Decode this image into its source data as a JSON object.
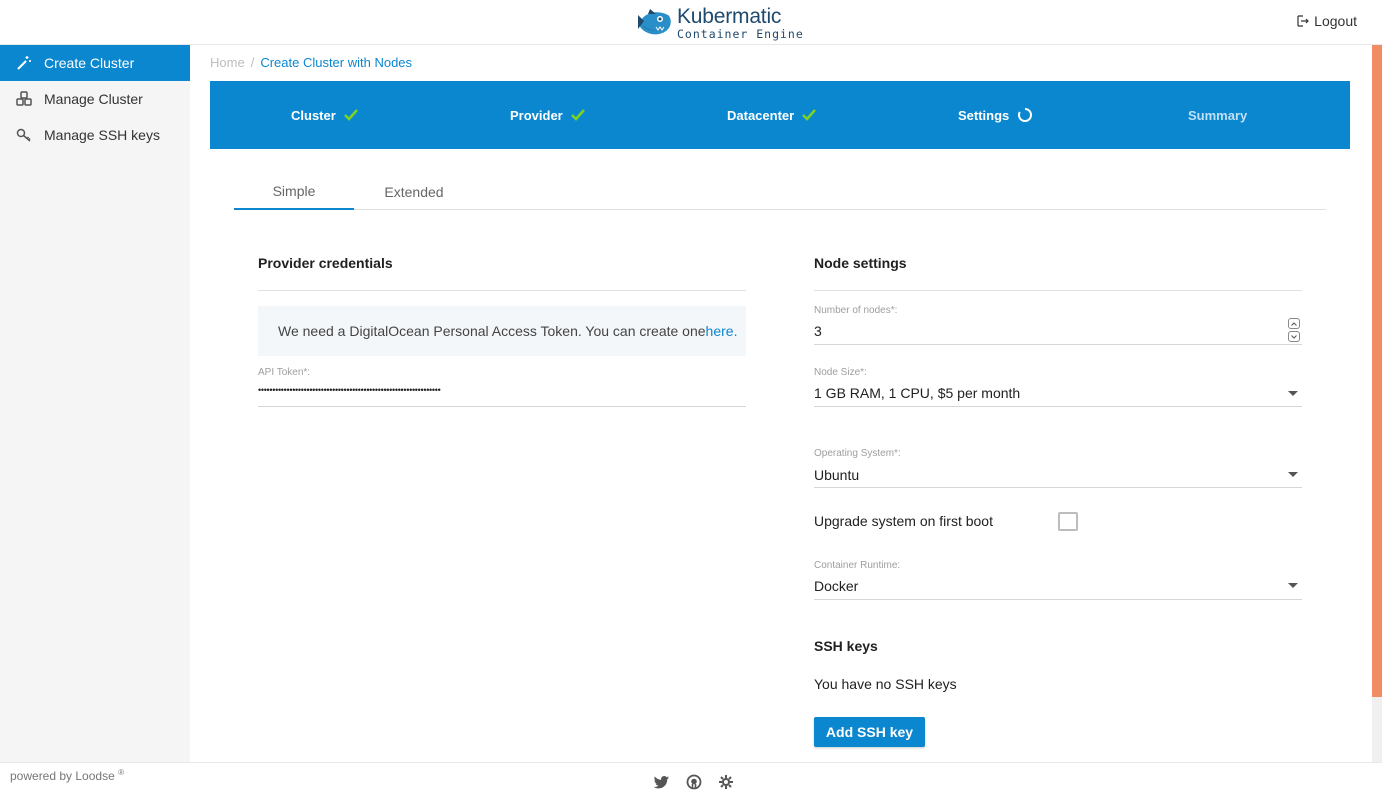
{
  "header": {
    "logo_name": "Kubermatic",
    "logo_sub": "Container Engine",
    "logout_label": "Logout"
  },
  "sidebar": {
    "items": [
      {
        "label": "Create Cluster",
        "icon": "wand-icon",
        "active": true
      },
      {
        "label": "Manage Cluster",
        "icon": "cubes-icon",
        "active": false
      },
      {
        "label": "Manage SSH keys",
        "icon": "key-icon",
        "active": false
      }
    ]
  },
  "breadcrumb": {
    "home": "Home",
    "separator": "/",
    "current": "Create Cluster with Nodes"
  },
  "stepper": {
    "steps": [
      {
        "label": "Cluster",
        "status": "done"
      },
      {
        "label": "Provider",
        "status": "done"
      },
      {
        "label": "Datacenter",
        "status": "done"
      },
      {
        "label": "Settings",
        "status": "in-progress"
      },
      {
        "label": "Summary",
        "status": "pending"
      }
    ]
  },
  "tabs": {
    "simple": "Simple",
    "extended": "Extended",
    "active": "Simple"
  },
  "provider": {
    "title": "Provider credentials",
    "info_text": "We need a DigitalOcean Personal Access Token. You can create one ",
    "info_link": "here.",
    "api_token_label": "API Token*:",
    "api_token_value": "••••••••••••••••••••••••••••••••••••••••••••••••••••••••••••••••"
  },
  "node_settings": {
    "title": "Node settings",
    "count_label": "Number of nodes*:",
    "count_value": "3",
    "size_label": "Node Size*:",
    "size_value": "1 GB RAM, 1 CPU, $5 per month",
    "os_label": "Operating System*:",
    "os_value": "Ubuntu",
    "upgrade_label": "Upgrade system on first boot",
    "upgrade_checked": false,
    "runtime_label": "Container Runtime:",
    "runtime_value": "Docker"
  },
  "ssh": {
    "title": "SSH keys",
    "empty_text": "You have no SSH keys",
    "add_button": "Add SSH key"
  },
  "footer": {
    "powered_by": "powered by Loodse",
    "registered": "®",
    "icons": [
      "twitter-icon",
      "github-icon",
      "settings-gear-icon"
    ]
  },
  "colors": {
    "primary": "#0b87d0",
    "check": "#7ed321",
    "scroll_thumb": "#f08b64"
  }
}
